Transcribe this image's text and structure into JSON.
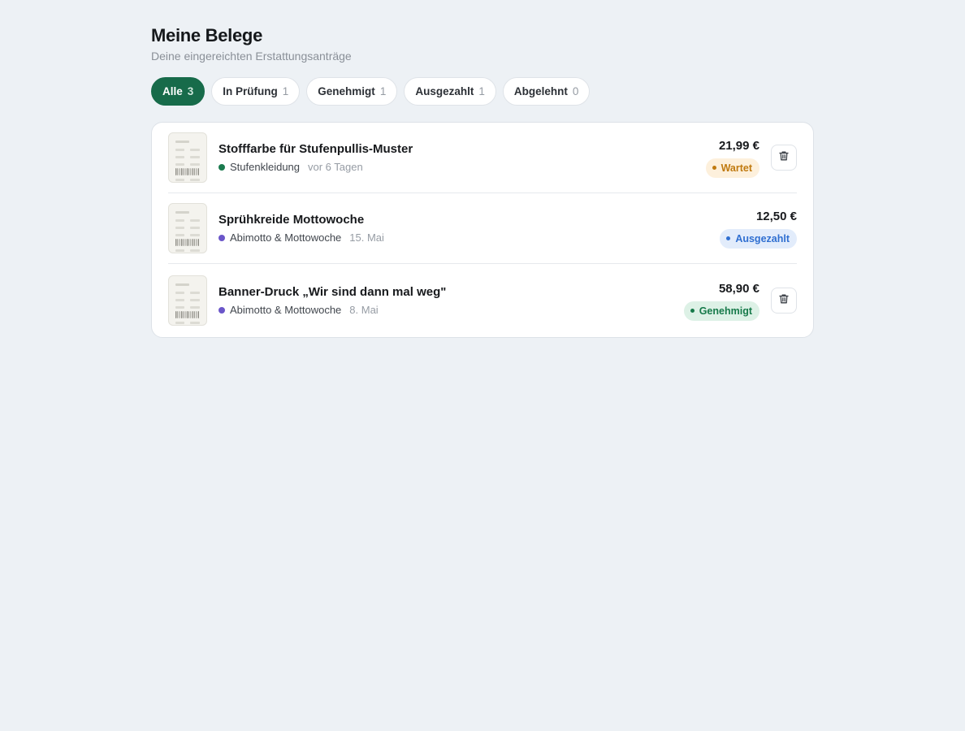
{
  "header": {
    "title": "Meine Belege",
    "subtitle": "Deine eingereichten Erstattungsanträge"
  },
  "filters": [
    {
      "label": "Alle",
      "count": "3",
      "active": true
    },
    {
      "label": "In Prüfung",
      "count": "1",
      "active": false
    },
    {
      "label": "Genehmigt",
      "count": "1",
      "active": false
    },
    {
      "label": "Ausgezahlt",
      "count": "1",
      "active": false
    },
    {
      "label": "Abgelehnt",
      "count": "0",
      "active": false
    }
  ],
  "receipts": [
    {
      "title": "Stofffarbe für Stufenpullis-Muster",
      "category": "Stufenkleidung",
      "category_color": "#1a7a4e",
      "date": "vor 6 Tagen",
      "amount": "21,99 €",
      "status": "Wartet",
      "status_color": "#c07a10",
      "status_bg": "#fdf0dc",
      "deletable": true
    },
    {
      "title": "Sprühkreide Mottowoche",
      "category": "Abimotto & Mottowoche",
      "category_color": "#6b56c9",
      "date": "15. Mai",
      "amount": "12,50 €",
      "status": "Ausgezahlt",
      "status_color": "#2f6fd1",
      "status_bg": "#e2ecfb",
      "deletable": false
    },
    {
      "title": "Banner-Druck „Wir sind dann mal weg\"",
      "category": "Abimotto & Mottowoche",
      "category_color": "#6b56c9",
      "date": "8. Mai",
      "amount": "58,90 €",
      "status": "Genehmigt",
      "status_color": "#177a4a",
      "status_bg": "#ddf1e6",
      "deletable": true
    }
  ],
  "icons": {
    "receipt": "receipt-thumbnail-icon",
    "delete": "trash-icon"
  }
}
